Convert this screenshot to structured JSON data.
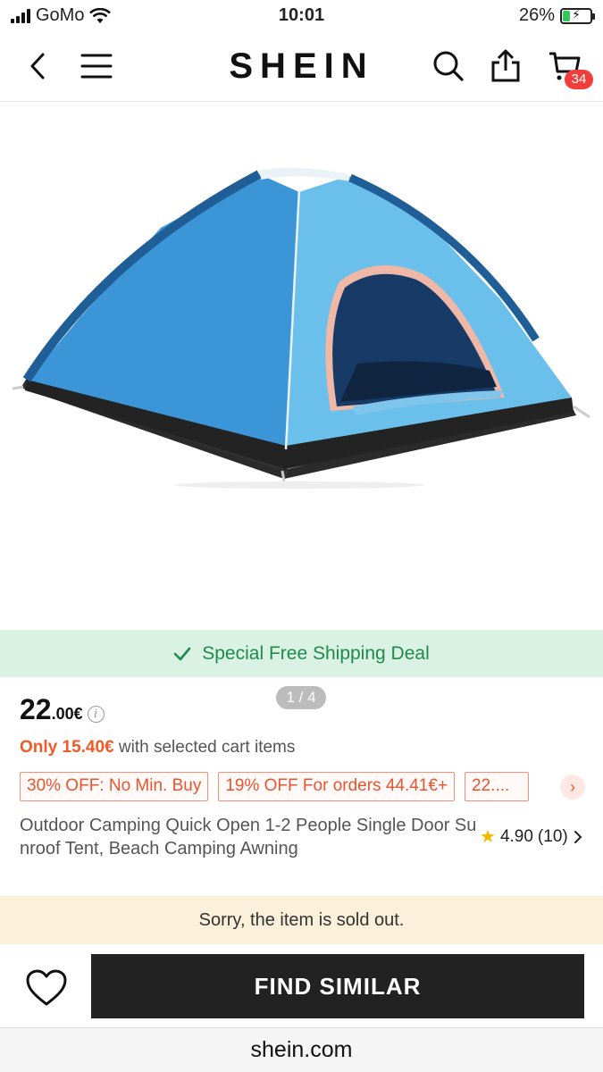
{
  "status_bar": {
    "carrier": "GoMo",
    "time": "10:01",
    "battery": "26%",
    "battery_level": 0.26
  },
  "nav": {
    "brand": "SHEIN",
    "cart_count": "34"
  },
  "gallery": {
    "pager": "1 / 4"
  },
  "shipping": {
    "text": "Special Free Shipping Deal"
  },
  "price": {
    "int": "22",
    "dec": ".00€",
    "info": "i"
  },
  "promo": {
    "only": "Only 15.40€",
    "rest": " with selected cart items"
  },
  "coupons": [
    "30% OFF: No Min. Buy",
    "19% OFF For orders 44.41€+",
    "22...."
  ],
  "product": {
    "title": "Outdoor Camping Quick Open 1-2 People Single Door Sunroof Tent, Beach Camping Awning",
    "rating": "4.90",
    "reviews": "(10)"
  },
  "soldout": {
    "text": "Sorry, the item is sold out."
  },
  "actions": {
    "find_similar": "FIND SIMILAR"
  },
  "url": "shein.com",
  "colors": {
    "accent": "#f05a27",
    "shipping": "#1f8a4c",
    "badge": "#f23d3d"
  }
}
